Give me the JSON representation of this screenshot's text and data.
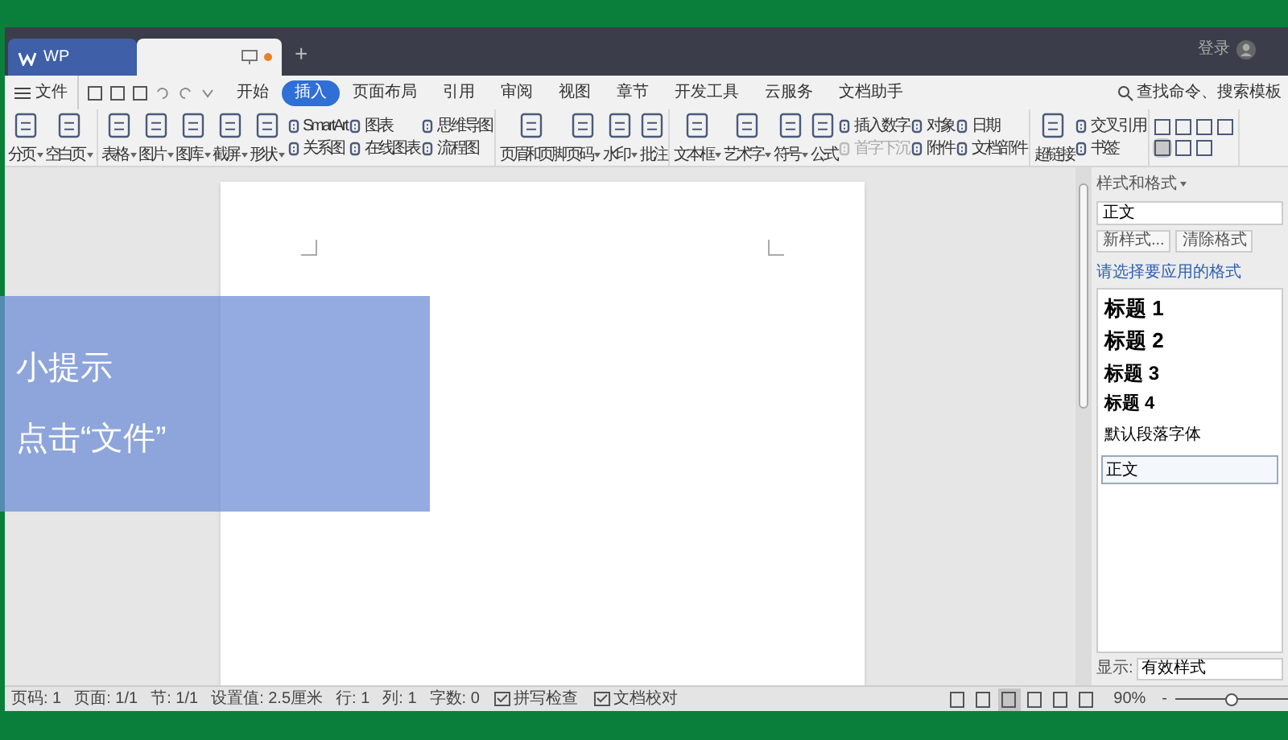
{
  "title_bar": {
    "tabs": [
      {
        "title": "WP",
        "selected": false,
        "modified": false
      },
      {
        "selected": true,
        "modified": true
      }
    ],
    "new_tab": "+",
    "login": "登录"
  },
  "menu_bar": {
    "file": "文件",
    "tabs": [
      {
        "label": "开始",
        "selected": false
      },
      {
        "label": "插入",
        "selected": true
      },
      {
        "label": "页面布局",
        "selected": false
      },
      {
        "label": "引用",
        "selected": false
      },
      {
        "label": "审阅",
        "selected": false
      },
      {
        "label": "视图",
        "selected": false
      },
      {
        "label": "章节",
        "selected": false
      },
      {
        "label": "开发工具",
        "selected": false
      },
      {
        "label": "云服务",
        "selected": false
      },
      {
        "label": "文档助手",
        "selected": false
      }
    ],
    "search": "查找命令、搜索模板"
  },
  "ribbon": {
    "groups": [
      {
        "items": [
          {
            "kind": "large",
            "label": "分页",
            "dropdown": true
          },
          {
            "kind": "large",
            "label": "空白页",
            "dropdown": true
          }
        ]
      },
      {
        "items": [
          {
            "kind": "large",
            "label": "表格",
            "dropdown": true
          },
          {
            "kind": "large",
            "label": "图片",
            "dropdown": true
          },
          {
            "kind": "large",
            "label": "图库",
            "dropdown": true
          },
          {
            "kind": "large",
            "label": "截屏",
            "dropdown": true
          },
          {
            "kind": "large",
            "label": "形状",
            "dropdown": true
          },
          {
            "kind": "stack",
            "items": [
              {
                "label": "SmartArt",
                "disabled": false
              },
              {
                "label": "关系图",
                "disabled": false
              }
            ]
          },
          {
            "kind": "stack",
            "items": [
              {
                "label": "图表",
                "disabled": false
              },
              {
                "label": "在线图表",
                "disabled": false
              }
            ]
          },
          {
            "kind": "stack",
            "items": [
              {
                "label": "思维导图",
                "disabled": false
              },
              {
                "label": "流程图",
                "disabled": false
              }
            ]
          }
        ]
      },
      {
        "items": [
          {
            "kind": "large",
            "label": "页眉和页脚",
            "dropdown": false
          },
          {
            "kind": "large",
            "label": "页码",
            "dropdown": true
          },
          {
            "kind": "large",
            "label": "水印",
            "dropdown": true
          },
          {
            "kind": "large",
            "label": "批注",
            "dropdown": false
          }
        ]
      },
      {
        "items": [
          {
            "kind": "large",
            "label": "文本框",
            "dropdown": true
          },
          {
            "kind": "large",
            "label": "艺术字",
            "dropdown": true
          },
          {
            "kind": "large",
            "label": "符号",
            "dropdown": true
          },
          {
            "kind": "large",
            "label": "公式",
            "dropdown": false
          },
          {
            "kind": "stack",
            "items": [
              {
                "label": "插入数字",
                "disabled": false
              },
              {
                "label": "首字下沉",
                "disabled": true
              }
            ]
          },
          {
            "kind": "stack",
            "items": [
              {
                "label": "对象",
                "disabled": false
              },
              {
                "label": "附件",
                "disabled": false
              }
            ]
          },
          {
            "kind": "stack",
            "items": [
              {
                "label": "日期",
                "disabled": false
              },
              {
                "label": "文档部件",
                "disabled": false
              }
            ]
          }
        ]
      },
      {
        "items": [
          {
            "kind": "large",
            "label": "超链接",
            "dropdown": false
          },
          {
            "kind": "stack",
            "items": [
              {
                "label": "交叉引用",
                "disabled": false
              },
              {
                "label": "书签",
                "disabled": false
              }
            ]
          }
        ]
      },
      {
        "items": [
          {
            "kind": "grid",
            "buttons": [
              {
                "selected": false
              },
              {
                "selected": false
              },
              {
                "selected": false
              },
              {
                "selected": false
              },
              {
                "selected": true
              },
              {
                "selected": false
              },
              {
                "selected": false
              }
            ]
          }
        ]
      }
    ]
  },
  "tip": {
    "title": "小提示",
    "text": "点击“文件”"
  },
  "styles_panel": {
    "title": "样式和格式",
    "current": "正文",
    "buttons": [
      "新样式...",
      "清除格式"
    ],
    "prompt": "请选择要应用的格式",
    "styles": [
      {
        "name": "标题 1",
        "kind": "h1",
        "selected": false
      },
      {
        "name": "标题 2",
        "kind": "h2",
        "selected": false
      },
      {
        "name": "标题 3",
        "kind": "h3",
        "selected": false
      },
      {
        "name": "标题 4",
        "kind": "h4",
        "selected": false
      },
      {
        "name": "默认段落字体",
        "kind": "plain",
        "selected": false
      },
      {
        "name": "正文",
        "kind": "plain",
        "selected": true
      }
    ],
    "show_label": "显示:",
    "show_value": "有效样式"
  },
  "status_bar": {
    "items": [
      {
        "kind": "text",
        "label": "页码: 1"
      },
      {
        "kind": "text",
        "label": "页面: 1/1"
      },
      {
        "kind": "text",
        "label": "节: 1/1"
      },
      {
        "kind": "text",
        "label": "设置值: 2.5厘米"
      },
      {
        "kind": "text",
        "label": "行: 1"
      },
      {
        "kind": "text",
        "label": "列: 1"
      },
      {
        "kind": "text",
        "label": "字数: 0"
      },
      {
        "kind": "icon",
        "label": "拼写检查"
      },
      {
        "kind": "icon",
        "label": "文档校对"
      }
    ],
    "views": [
      {
        "selected": false
      },
      {
        "selected": false
      },
      {
        "selected": true
      },
      {
        "selected": false
      },
      {
        "selected": false
      },
      {
        "selected": false
      }
    ],
    "zoom": "90%",
    "zoom_minus": "-",
    "zoom_slider": {
      "level": 0.5
    }
  }
}
